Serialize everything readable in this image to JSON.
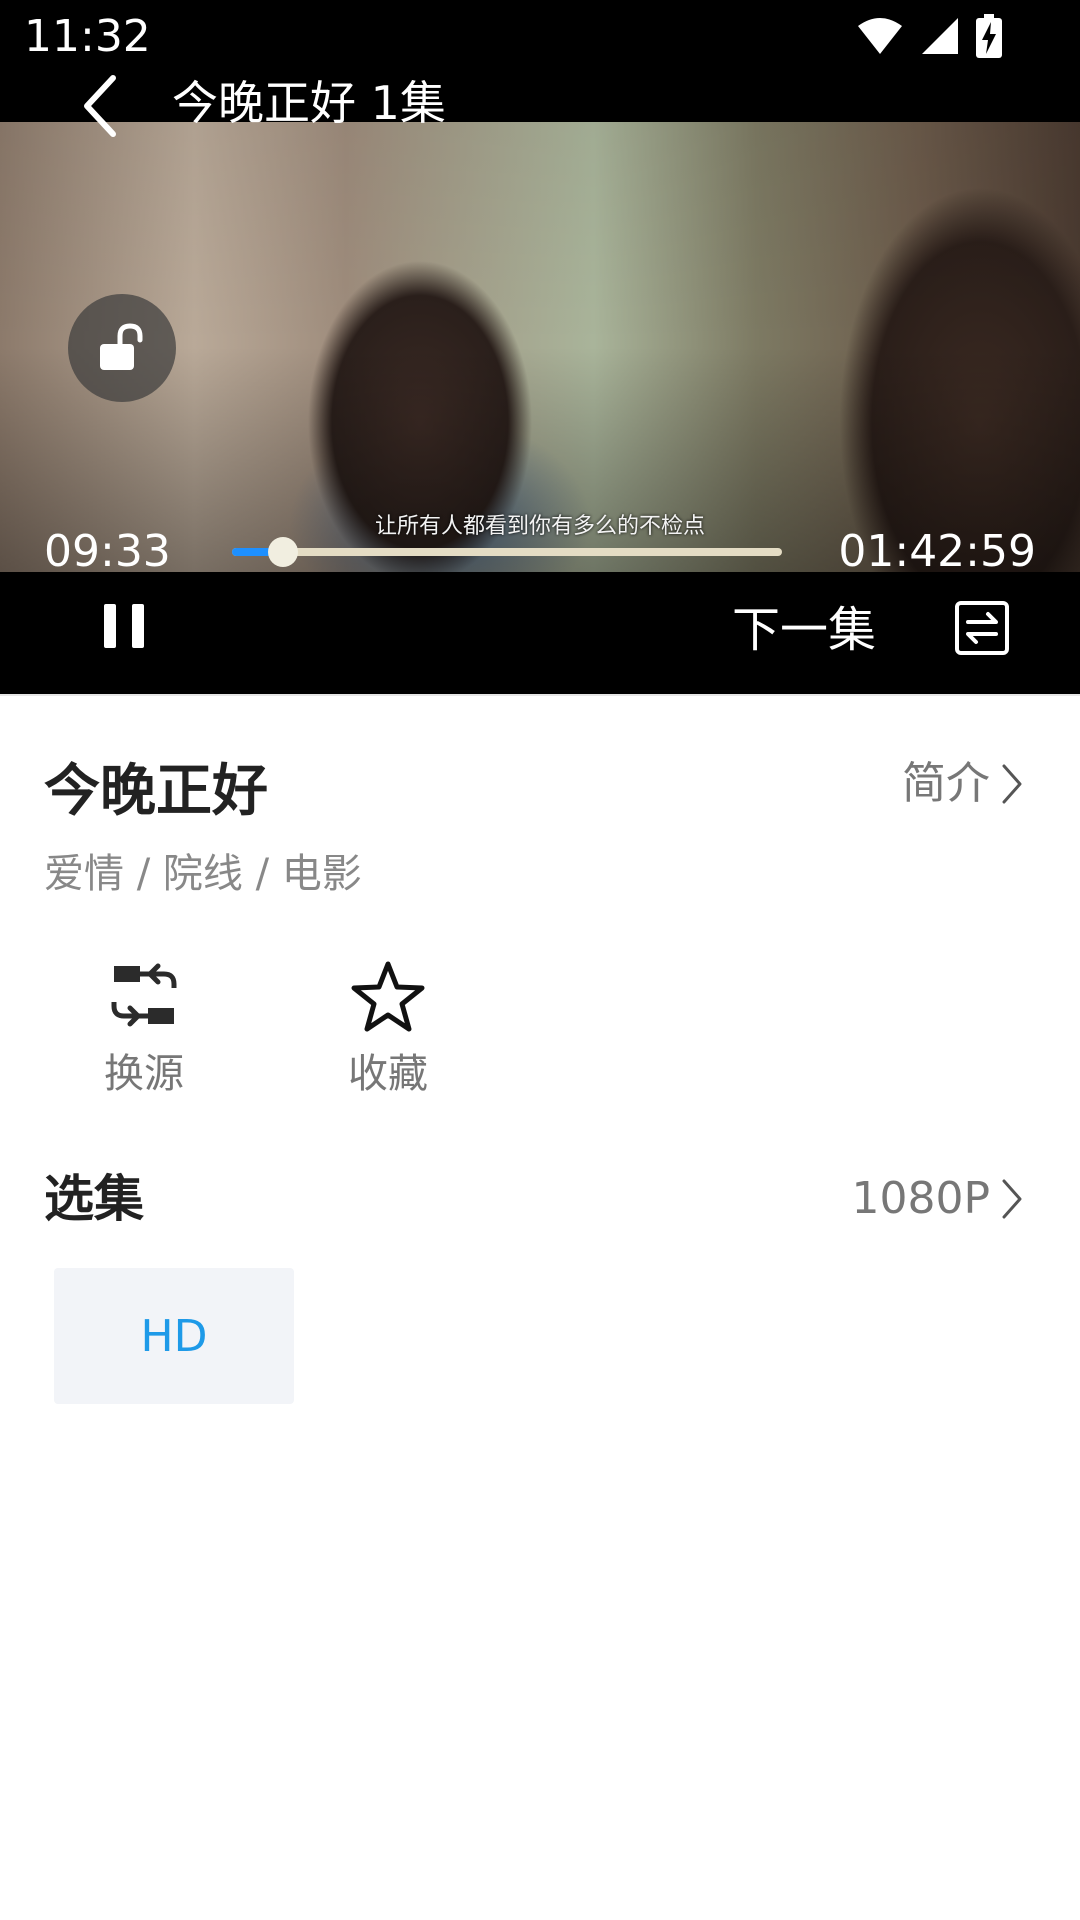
{
  "status_bar": {
    "time": "11:32",
    "icons": [
      "wifi-icon",
      "signal-icon",
      "battery-charging-icon"
    ]
  },
  "player": {
    "title": "今晚正好 1集",
    "subtitle": "让所有人都看到你有多么的不检点",
    "current_time": "09:33",
    "total_time": "01:42:59",
    "progress_fraction": 0.093,
    "next_label": "下一集",
    "accent_color": "#1e90ff"
  },
  "details": {
    "title": "今晚正好",
    "intro_label": "简介",
    "tags": "爱情 / 院线 / 电影",
    "actions": [
      {
        "label": "换源",
        "icon": "swap-source-icon"
      },
      {
        "label": "收藏",
        "icon": "star-icon"
      }
    ],
    "episodes_title": "选集",
    "quality_label": "1080P",
    "episodes": [
      "HD"
    ],
    "episode_color": "#1e9ae8"
  }
}
